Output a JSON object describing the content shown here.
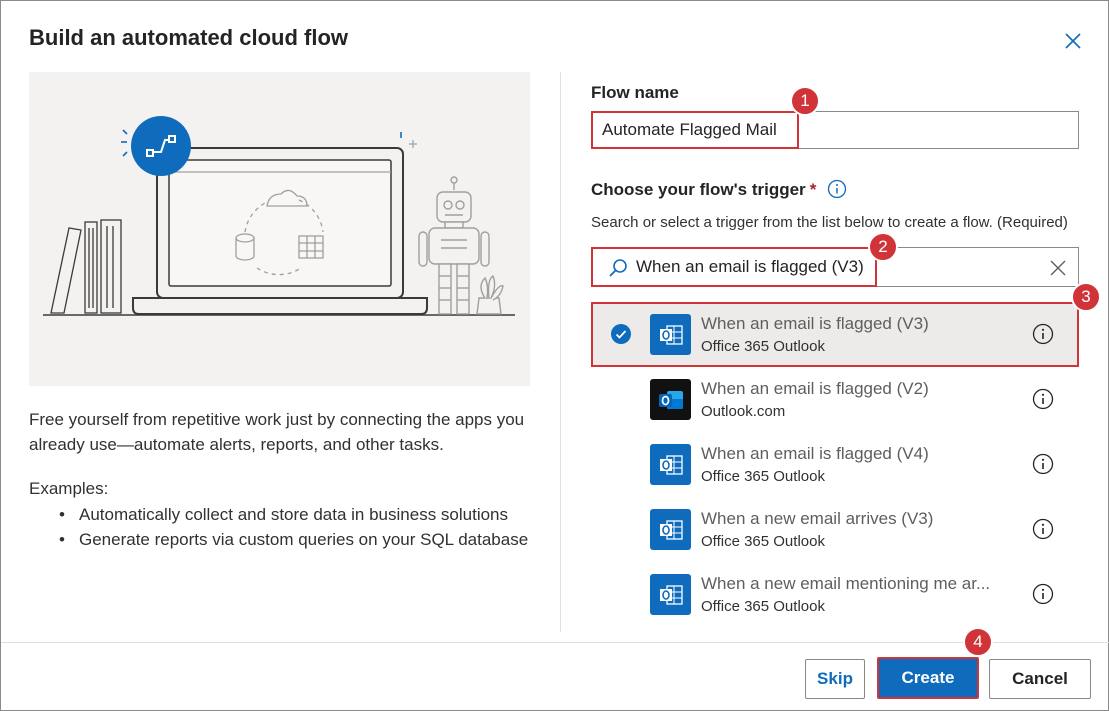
{
  "dialog": {
    "title": "Build an automated cloud flow",
    "close_icon": "close-icon"
  },
  "left": {
    "description": "Free yourself from repetitive work just by connecting the apps you already use—automate alerts, reports, and other tasks.",
    "examples_title": "Examples:",
    "examples": [
      "Automatically collect and store data in business solutions",
      "Generate reports via custom queries on your SQL database"
    ]
  },
  "form": {
    "flow_name_label": "Flow name",
    "flow_name_value": "Automate Flagged Mail",
    "trigger_label": "Choose your flow's trigger",
    "required_mark": "*",
    "trigger_help": "Search or select a trigger from the list below to create a flow. (Required)",
    "search_value": "When an email is flagged (V3)"
  },
  "triggers": [
    {
      "name": "When an email is flagged (V3)",
      "connector": "Office 365 Outlook",
      "icon": "office365-outlook-icon",
      "selected": true
    },
    {
      "name": "When an email is flagged (V2)",
      "connector": "Outlook.com",
      "icon": "outlook-com-icon",
      "selected": false
    },
    {
      "name": "When an email is flagged (V4)",
      "connector": "Office 365 Outlook",
      "icon": "office365-outlook-icon",
      "selected": false
    },
    {
      "name": "When a new email arrives (V3)",
      "connector": "Office 365 Outlook",
      "icon": "office365-outlook-icon",
      "selected": false
    },
    {
      "name": "When a new email mentioning me ar...",
      "connector": "Office 365 Outlook",
      "icon": "office365-outlook-icon",
      "selected": false
    }
  ],
  "buttons": {
    "skip": "Skip",
    "create": "Create",
    "cancel": "Cancel"
  },
  "callouts": [
    "1",
    "2",
    "3",
    "4"
  ],
  "colors": {
    "accent": "#0f6cbd",
    "callout": "#d13438",
    "illustration_bg": "#f3f2f1"
  }
}
